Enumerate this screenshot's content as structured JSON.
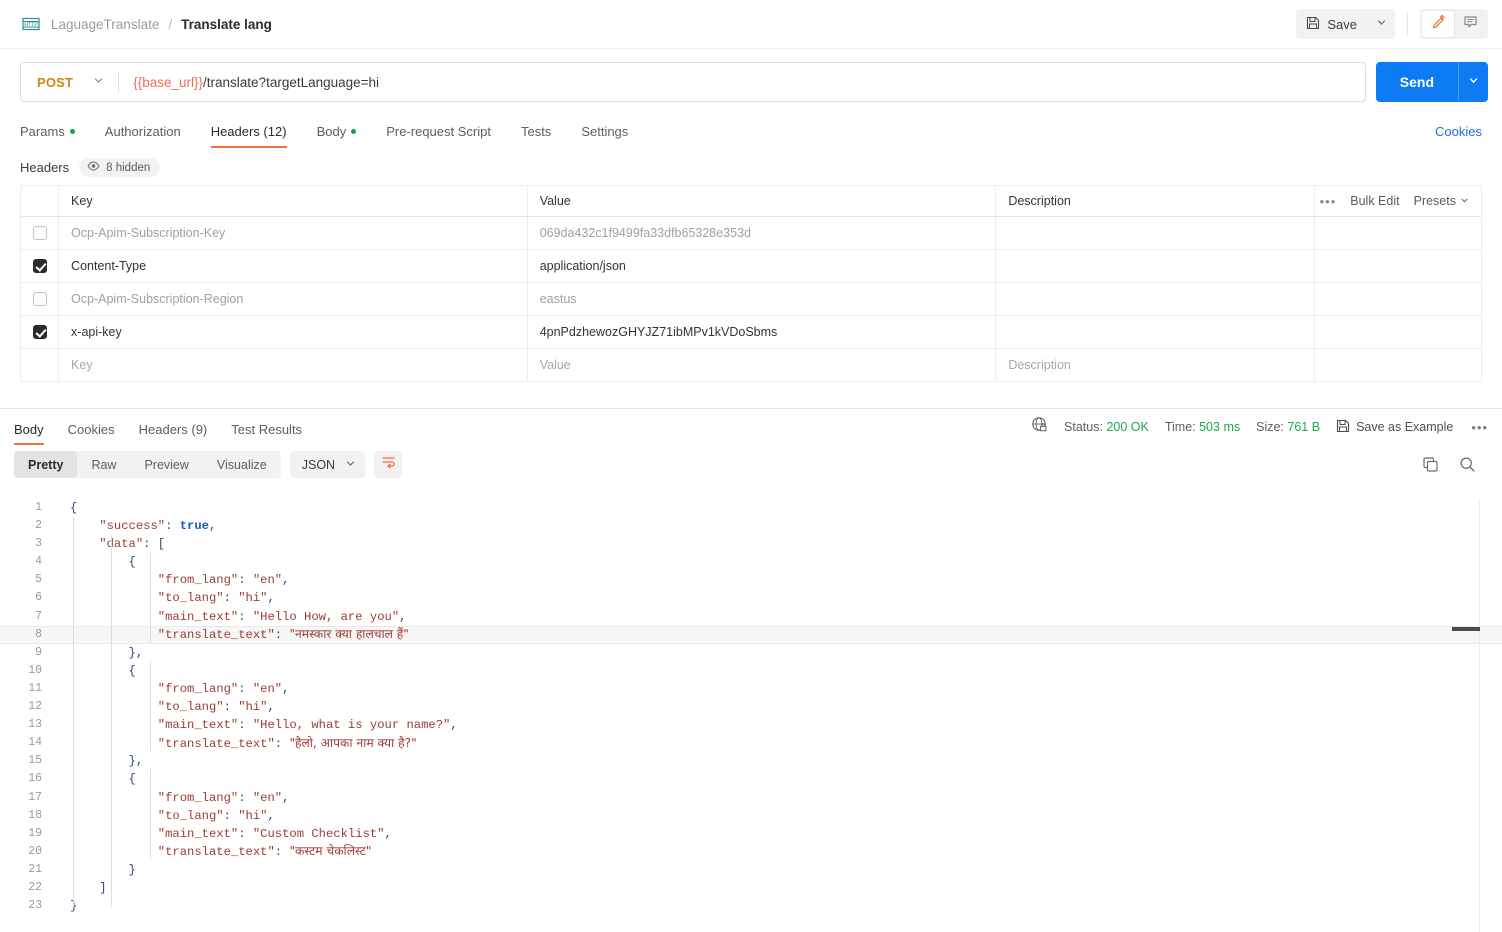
{
  "breadcrumb": {
    "icon": "http-icon",
    "collection": "LaguageTranslate",
    "separator": "/",
    "request_name": "Translate lang"
  },
  "topbar": {
    "save_label": "Save",
    "save_icon": "floppy-disk-icon",
    "save_caret_icon": "chevron-down-icon",
    "edit_icon": "pencil-icon",
    "comment_icon": "comment-icon"
  },
  "url_bar": {
    "method": "POST",
    "method_caret_icon": "chevron-down-icon",
    "url_variable": "{{base_url}}",
    "url_rest": "/translate?targetLanguage=hi",
    "send_label": "Send",
    "send_caret_icon": "chevron-down-icon"
  },
  "request_tabs": {
    "items": [
      {
        "label": "Params",
        "dot": true,
        "active": false
      },
      {
        "label": "Authorization",
        "dot": false,
        "active": false
      },
      {
        "label": "Headers (12)",
        "dot": false,
        "active": true
      },
      {
        "label": "Body",
        "dot": true,
        "active": false
      },
      {
        "label": "Pre-request Script",
        "dot": false,
        "active": false
      },
      {
        "label": "Tests",
        "dot": false,
        "active": false
      },
      {
        "label": "Settings",
        "dot": false,
        "active": false
      }
    ],
    "cookies_link": "Cookies"
  },
  "headers_section": {
    "title": "Headers",
    "hidden_badge": "8 hidden",
    "hidden_icon": "eye-icon",
    "columns": [
      "Key",
      "Value",
      "Description"
    ],
    "options": {
      "more_icon": "ellipsis-icon",
      "bulk_edit": "Bulk Edit",
      "presets": "Presets",
      "presets_caret_icon": "chevron-down-icon"
    },
    "rows": [
      {
        "checked": false,
        "key": "Ocp-Apim-Subscription-Key",
        "value": "069da432c1f9499fa33dfb65328e353d",
        "description": "",
        "dim": true
      },
      {
        "checked": true,
        "key": "Content-Type",
        "value": "application/json",
        "description": "",
        "dim": false
      },
      {
        "checked": false,
        "key": "Ocp-Apim-Subscription-Region",
        "value": "eastus",
        "description": "",
        "dim": true
      },
      {
        "checked": true,
        "key": "x-api-key",
        "value": "4pnPdzhewozGHYJZ71ibMPv1kVDoSbms",
        "description": "",
        "dim": false
      }
    ],
    "placeholder_row": {
      "key": "Key",
      "value": "Value",
      "description": "Description"
    }
  },
  "response": {
    "tabs": [
      {
        "label": "Body",
        "active": true
      },
      {
        "label": "Cookies",
        "active": false
      },
      {
        "label": "Headers (9)",
        "active": false
      },
      {
        "label": "Test Results",
        "active": false
      }
    ],
    "meta": {
      "globe_icon": "globe-lock-icon",
      "status_label": "Status:",
      "status_value": "200 OK",
      "time_label": "Time:",
      "time_value": "503 ms",
      "size_label": "Size:",
      "size_value": "761 B",
      "save_example_icon": "floppy-disk-icon",
      "save_example": "Save as Example",
      "more_icon": "ellipsis-icon"
    },
    "toolbar": {
      "views": [
        {
          "label": "Pretty",
          "active": true
        },
        {
          "label": "Raw",
          "active": false
        },
        {
          "label": "Preview",
          "active": false
        },
        {
          "label": "Visualize",
          "active": false
        }
      ],
      "format": "JSON",
      "format_caret_icon": "chevron-down-icon",
      "wrap_icon": "word-wrap-icon",
      "copy_icon": "copy-icon",
      "search_icon": "search-icon"
    },
    "body_lines": [
      {
        "n": 1,
        "segments": [
          {
            "t": "{",
            "c": "tok-pun"
          }
        ],
        "indent": 0
      },
      {
        "n": 2,
        "segments": [
          {
            "t": "\"success\"",
            "c": "tok-key"
          },
          {
            "t": ": ",
            "c": "tok-pun"
          },
          {
            "t": "true",
            "c": "tok-bool"
          },
          {
            "t": ",",
            "c": "tok-pun"
          }
        ],
        "indent": 1
      },
      {
        "n": 3,
        "segments": [
          {
            "t": "\"data\"",
            "c": "tok-key"
          },
          {
            "t": ": [",
            "c": "tok-pun"
          }
        ],
        "indent": 1
      },
      {
        "n": 4,
        "segments": [
          {
            "t": "{",
            "c": "tok-pun"
          }
        ],
        "indent": 2
      },
      {
        "n": 5,
        "segments": [
          {
            "t": "\"from_lang\"",
            "c": "tok-key"
          },
          {
            "t": ": ",
            "c": "tok-pun"
          },
          {
            "t": "\"en\"",
            "c": "tok-str"
          },
          {
            "t": ",",
            "c": "tok-pun"
          }
        ],
        "indent": 3
      },
      {
        "n": 6,
        "segments": [
          {
            "t": "\"to_lang\"",
            "c": "tok-key"
          },
          {
            "t": ": ",
            "c": "tok-pun"
          },
          {
            "t": "\"hi\"",
            "c": "tok-str"
          },
          {
            "t": ",",
            "c": "tok-pun"
          }
        ],
        "indent": 3
      },
      {
        "n": 7,
        "segments": [
          {
            "t": "\"main_text\"",
            "c": "tok-key"
          },
          {
            "t": ": ",
            "c": "tok-pun"
          },
          {
            "t": "\"Hello How, are you\"",
            "c": "tok-str"
          },
          {
            "t": ",",
            "c": "tok-pun"
          }
        ],
        "indent": 3
      },
      {
        "n": 8,
        "segments": [
          {
            "t": "\"translate_text\"",
            "c": "tok-key"
          },
          {
            "t": ": ",
            "c": "tok-pun"
          },
          {
            "t": "\"नमस्कार क्या हालचाल हैं\"",
            "c": "tok-dev"
          }
        ],
        "indent": 3,
        "highlight": true
      },
      {
        "n": 9,
        "segments": [
          {
            "t": "},",
            "c": "tok-pun"
          }
        ],
        "indent": 2
      },
      {
        "n": 10,
        "segments": [
          {
            "t": "{",
            "c": "tok-pun"
          }
        ],
        "indent": 2
      },
      {
        "n": 11,
        "segments": [
          {
            "t": "\"from_lang\"",
            "c": "tok-key"
          },
          {
            "t": ": ",
            "c": "tok-pun"
          },
          {
            "t": "\"en\"",
            "c": "tok-str"
          },
          {
            "t": ",",
            "c": "tok-pun"
          }
        ],
        "indent": 3
      },
      {
        "n": 12,
        "segments": [
          {
            "t": "\"to_lang\"",
            "c": "tok-key"
          },
          {
            "t": ": ",
            "c": "tok-pun"
          },
          {
            "t": "\"hi\"",
            "c": "tok-str"
          },
          {
            "t": ",",
            "c": "tok-pun"
          }
        ],
        "indent": 3
      },
      {
        "n": 13,
        "segments": [
          {
            "t": "\"main_text\"",
            "c": "tok-key"
          },
          {
            "t": ": ",
            "c": "tok-pun"
          },
          {
            "t": "\"Hello, what is your name?\"",
            "c": "tok-str"
          },
          {
            "t": ",",
            "c": "tok-pun"
          }
        ],
        "indent": 3
      },
      {
        "n": 14,
        "segments": [
          {
            "t": "\"translate_text\"",
            "c": "tok-key"
          },
          {
            "t": ": ",
            "c": "tok-pun"
          },
          {
            "t": "\"हैलो, आपका नाम क्या है?\"",
            "c": "tok-dev"
          }
        ],
        "indent": 3
      },
      {
        "n": 15,
        "segments": [
          {
            "t": "},",
            "c": "tok-pun"
          }
        ],
        "indent": 2
      },
      {
        "n": 16,
        "segments": [
          {
            "t": "{",
            "c": "tok-pun"
          }
        ],
        "indent": 2
      },
      {
        "n": 17,
        "segments": [
          {
            "t": "\"from_lang\"",
            "c": "tok-key"
          },
          {
            "t": ": ",
            "c": "tok-pun"
          },
          {
            "t": "\"en\"",
            "c": "tok-str"
          },
          {
            "t": ",",
            "c": "tok-pun"
          }
        ],
        "indent": 3
      },
      {
        "n": 18,
        "segments": [
          {
            "t": "\"to_lang\"",
            "c": "tok-key"
          },
          {
            "t": ": ",
            "c": "tok-pun"
          },
          {
            "t": "\"hi\"",
            "c": "tok-str"
          },
          {
            "t": ",",
            "c": "tok-pun"
          }
        ],
        "indent": 3
      },
      {
        "n": 19,
        "segments": [
          {
            "t": "\"main_text\"",
            "c": "tok-key"
          },
          {
            "t": ": ",
            "c": "tok-pun"
          },
          {
            "t": "\"Custom Checklist\"",
            "c": "tok-str"
          },
          {
            "t": ",",
            "c": "tok-pun"
          }
        ],
        "indent": 3
      },
      {
        "n": 20,
        "segments": [
          {
            "t": "\"translate_text\"",
            "c": "tok-key"
          },
          {
            "t": ": ",
            "c": "tok-pun"
          },
          {
            "t": "\"कस्टम चेकलिस्ट\"",
            "c": "tok-dev"
          }
        ],
        "indent": 3
      },
      {
        "n": 21,
        "segments": [
          {
            "t": "}",
            "c": "tok-pun"
          }
        ],
        "indent": 2
      },
      {
        "n": 22,
        "segments": [
          {
            "t": "]",
            "c": "tok-pun"
          }
        ],
        "indent": 1
      },
      {
        "n": 23,
        "segments": [
          {
            "t": "}",
            "c": "tok-pun"
          }
        ],
        "indent": 0
      }
    ]
  },
  "colors": {
    "accent_orange": "#f2703b",
    "send_blue": "#0d7bf4",
    "link_blue": "#1f6fdd",
    "success_green": "#1ba94c",
    "method_post": "#c98a10",
    "variable_red": "#f06c5a"
  }
}
